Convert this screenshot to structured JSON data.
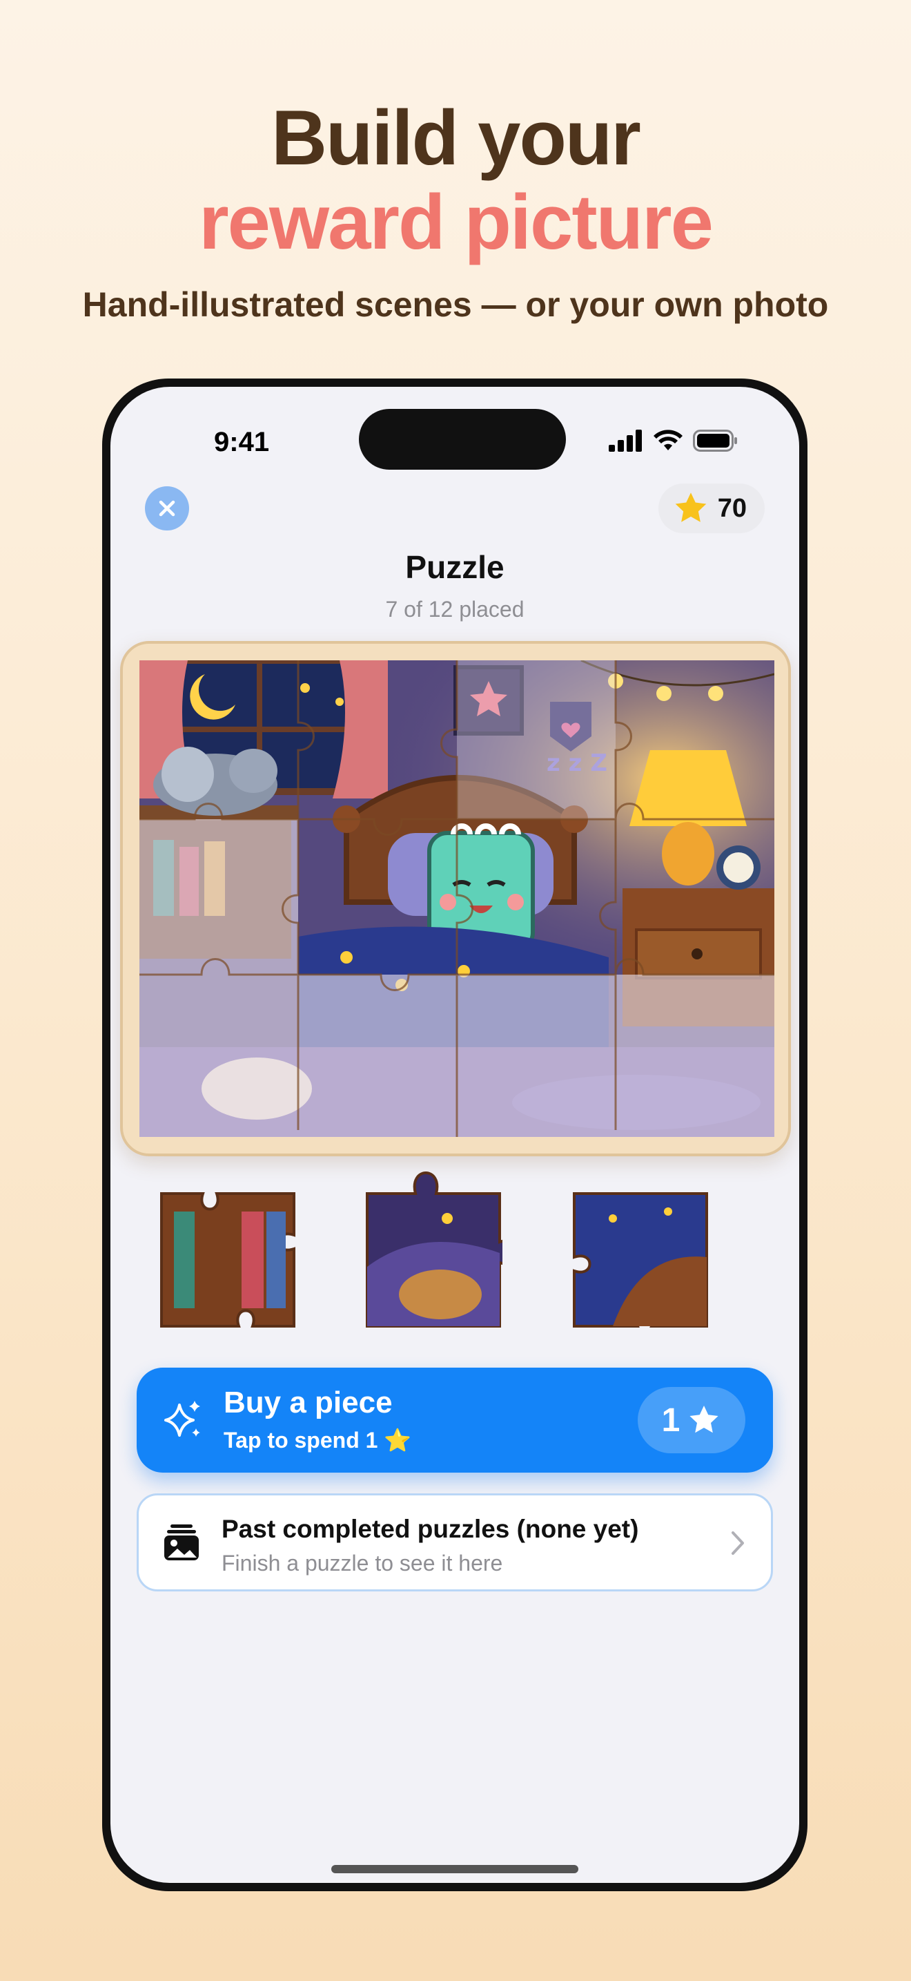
{
  "promo": {
    "headline_line1": "Build your",
    "headline_line2": "reward picture",
    "subtitle": "Hand-illustrated scenes — or your own photo"
  },
  "status_bar": {
    "time": "9:41"
  },
  "header": {
    "close_icon": "xmark-icon",
    "star_balance": "70",
    "title": "Puzzle",
    "progress_text": "7 of 12 placed"
  },
  "puzzle": {
    "pieces_total": 12,
    "pieces_placed": 7,
    "tray_pieces": 3
  },
  "buy_button": {
    "label": "Buy a piece",
    "sublabel": "Tap to spend 1 ⭐",
    "cost": "1",
    "icon": "sparkles-icon"
  },
  "past_puzzles": {
    "title": "Past completed puzzles (none yet)",
    "subtitle": "Finish a puzzle to see it here",
    "icon": "photo-stack-icon"
  },
  "colors": {
    "accent_blue": "#1484f8",
    "headline_brown": "#4e341c",
    "headline_coral": "#f0776e",
    "star_yellow": "#f8c21c"
  }
}
